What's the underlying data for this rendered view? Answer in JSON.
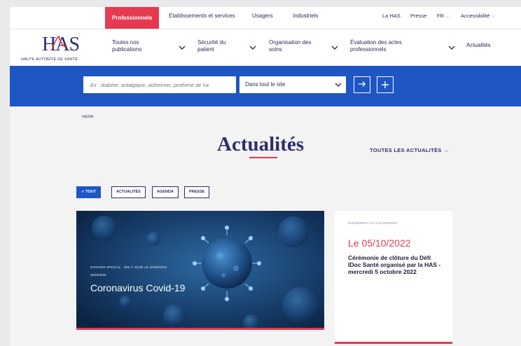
{
  "topbar": {
    "tabs": [
      {
        "label": "Professionnels",
        "active": true
      },
      {
        "label": "Etablissements et services",
        "active": false
      },
      {
        "label": "Usagers",
        "active": false
      },
      {
        "label": "Industriels",
        "active": false
      }
    ],
    "utility": {
      "about": "La HAS",
      "press": "Presse",
      "language": "FR",
      "accessibility": "Accessibilité"
    }
  },
  "logo": {
    "mark": "HAS",
    "subtitle": "HAUTE AUTORITÉ DE SANTÉ"
  },
  "mainnav": {
    "items": [
      {
        "label": "Toutes nos publications",
        "icon": "chevron-down-icon"
      },
      {
        "label": "Sécurité du patient",
        "icon": "chevron-down-icon"
      },
      {
        "label": "Organisation des soins",
        "icon": "chevron-down-icon"
      },
      {
        "label": "Évaluation des actes professionnels",
        "icon": "chevron-down-icon"
      },
      {
        "label": "Actualités"
      }
    ]
  },
  "search": {
    "placeholder": "Ex : diabète, antalgique, alzheimer, prothèse de ha",
    "scope_selected": "Dans tout le site",
    "submit_icon": "arrow-right-icon",
    "advanced_icon": "plus-icon"
  },
  "breadcrumb": "racine",
  "page": {
    "title": "Actualités",
    "all_news_link": "TOUTES LES ACTUALITÉS →"
  },
  "filters": [
    {
      "label": "✓ TOUT",
      "active": true
    },
    {
      "label": "ACTUALITÉS",
      "active": false
    },
    {
      "label": "AGENDA",
      "active": false
    },
    {
      "label": "PRESSE",
      "active": false
    }
  ],
  "hero": {
    "kicker": "DOSSIER SPÉCIAL · MIS À JOUR LE 30/09/2022",
    "date": "20/10/2020",
    "title": "Coronavirus Covid-19"
  },
  "event": {
    "kicker": "ÉVÉNEMENT DU CALENDRIER",
    "date": "Le 05/10/2022",
    "title": "Cérémonie de clôture du Défi IDoc Santé organisé par la HAS - mercredi 5 octobre 2022"
  },
  "colors": {
    "brand_red": "#e53a4f",
    "brand_blue": "#1e56c4",
    "navy": "#2c2e6d"
  }
}
